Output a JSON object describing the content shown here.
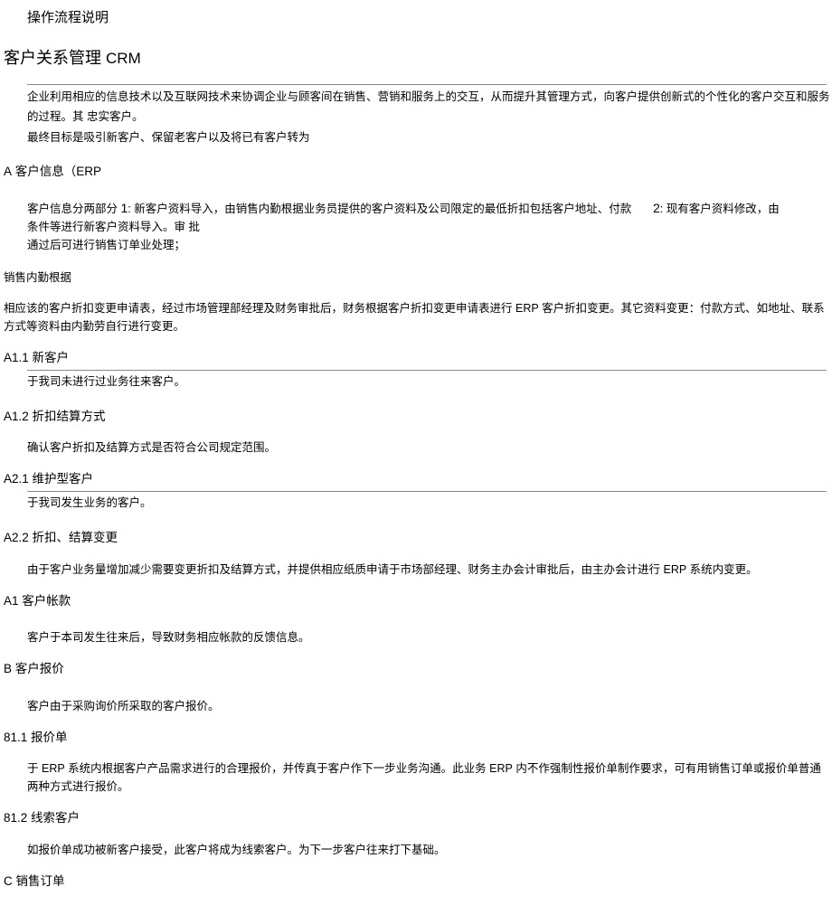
{
  "page_title": "操作流程说明",
  "main_heading_cn": "客户关系管理",
  "main_heading_en": "CRM",
  "intro_line1": "企业利用相应的信息技术以及互联网技术来协调企业与顾客间在销售、营销和服务上的交互，从而提升其管理方式，向客户提供创新式的个性化的客户交互和服务的过程。其 忠实客户。",
  "intro_line2": "最终目标是吸引新客户、保留老客户以及将已有客户转为",
  "sec_a_prefix": "A",
  "sec_a_text": " 客户信息（",
  "sec_a_suffix": "ERP",
  "a_block_left_a": "客户信息分两部分 ",
  "a_block_left_num1": "1",
  "a_block_left_b": ": 新客户资料导入，由销售内勤根据业务员提供的客户资料及公司限定的最低折扣包括客户地址、付款条件等进行新客户资料导入。审 批",
  "a_block_left_c": "通过后可进行销售订单业处理；",
  "a_block_right_num2": "2",
  "a_block_right_text": ": 现有客户资料修改，由",
  "a_inner_line": "销售内勤根据",
  "a_para_a": "相应该的客户折扣变更申请表，经过市场管理部经理及财务审批后，财务根据客户折扣变更申请表进行 ",
  "a_para_erp": "ERP",
  "a_para_b": " 客户折扣变更。其它资料变更：付款方式、如地址、联系方式等资料由内勤劳自行进行变更。",
  "a11_label_prefix": "A1.1",
  "a11_label_text": " 新客户",
  "a11_body": "于我司未进行过业务往来客户。",
  "a12_label_prefix": "A1.2",
  "a12_label_text": " 折扣结算方式",
  "a12_body": "确认客户折扣及结算方式是否符合公司规定范围。",
  "a21_label_prefix": "A2.1",
  "a21_label_text": " 维护型客户",
  "a21_body": "于我司发生业务的客户。",
  "a22_label_prefix": "A2.2",
  "a22_label_text": " 折扣、结算变更",
  "a22_body_a": "由于客户业务量增加减少需要变更折扣及结算方式，并提供相应纸质申请于市场部经理、财务主办会计审批后，由主办会计进行 ",
  "a22_body_erp": "ERP",
  "a22_body_b": " 系统内变更。",
  "a1_label_prefix": "A1",
  "a1_label_text": " 客户帐款",
  "a1_body": "客户于本司发生往来后，导致财务相应帐款的反馈信息。",
  "b_label_prefix": "B",
  "b_label_text": " 客户报价",
  "b_body": "客户由于采购询价所采取的客户报价。",
  "b81_label_prefix": "81.1",
  "b81_label_text": " 报价单",
  "b81_body_a": "于 ",
  "b81_body_erp1": "ERP",
  "b81_body_b": " 系统内根据客户产品需求进行的合理报价，并传真于客户作下一步业务沟通。此业务 ",
  "b81_body_erp2": "ERP",
  "b81_body_c": " 内不作强制性报价单制作要求，可有用销售订单或报价单普通两种方式进行报价。",
  "b82_label_prefix": "81.2",
  "b82_label_text": " 线索客户",
  "b82_body": "如报价单成功被新客户接受，此客户将成为线索客户。为下一步客户往来打下基础。",
  "c_label_prefix": "C",
  "c_label_text": " 销售订单"
}
